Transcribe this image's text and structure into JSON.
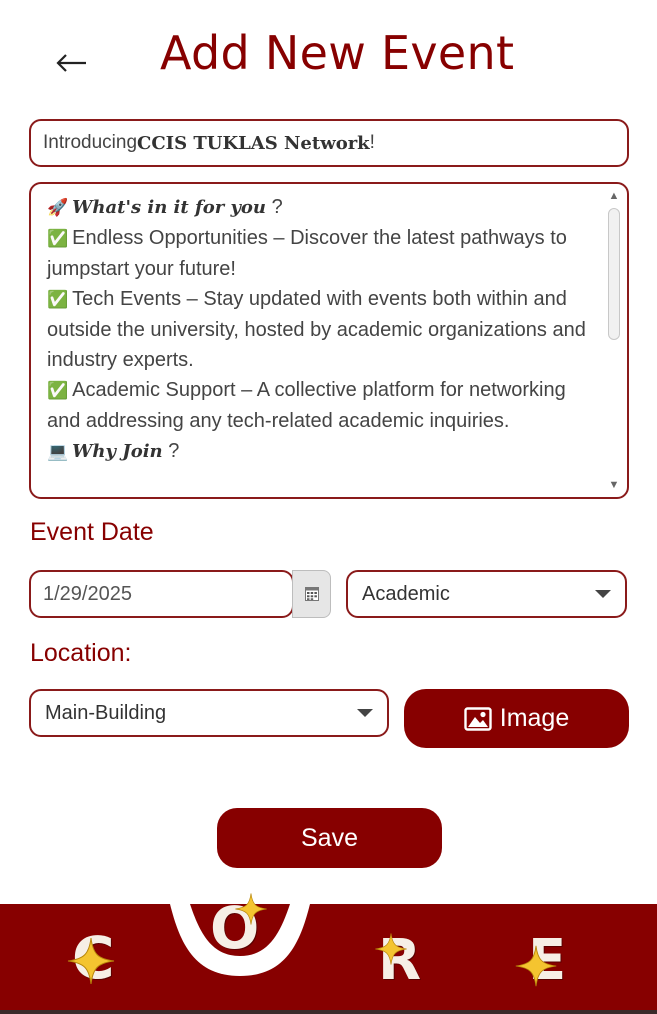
{
  "header": {
    "title": "Add New Event",
    "back_glyph": "←"
  },
  "form": {
    "title_field": {
      "prefix": "Introducing ",
      "bold": "CCIS TUKLAS Network",
      "suffix": "!"
    },
    "description": {
      "lines": [
        {
          "glyph": "🚀",
          "em": "What's in it for you",
          "text": " ?"
        },
        {
          "glyph": "✅",
          "em": "",
          "text": "Endless Opportunities – Discover the latest pathways to jumpstart your future!"
        },
        {
          "glyph": "✅",
          "em": "",
          "text": "Tech Events – Stay updated with events both within and outside the university, hosted by academic organizations and industry experts."
        },
        {
          "glyph": "✅",
          "em": "",
          "text": "Academic Support – A collective platform for networking and addressing any tech-related academic inquiries."
        },
        {
          "glyph": "💻",
          "em": "Why Join",
          "text": " ?"
        }
      ]
    },
    "event_date_label": "Event Date",
    "event_date_value": "1/29/2025",
    "category_value": "Academic",
    "location_label": "Location:",
    "location_value": "Main-Building",
    "image_button_label": "Image",
    "save_button_label": "Save"
  },
  "bottom_nav": {
    "items": [
      "C",
      "O",
      "R",
      "E"
    ]
  },
  "colors": {
    "primary": "#870000",
    "border": "#8a1a1a",
    "star": "#f4c430"
  },
  "icons": {
    "back": "back-arrow-icon",
    "calendar": "calendar-icon",
    "caret": "chevron-down-icon",
    "image": "image-icon",
    "star": "star-icon"
  }
}
